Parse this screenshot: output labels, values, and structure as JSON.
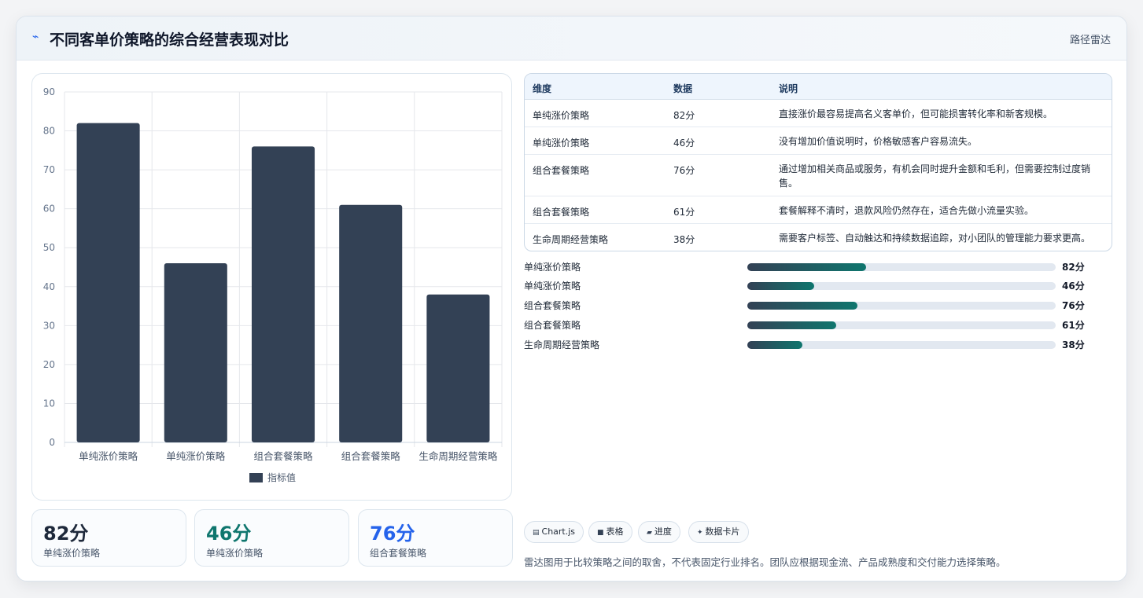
{
  "header": {
    "icon": "pulse-icon",
    "title": "不同客单价策略的综合经营表现对比",
    "badge": "路径雷达"
  },
  "chart_data": {
    "type": "bar",
    "categories": [
      "单纯涨价策略",
      "单纯涨价策略",
      "组合套餐策略",
      "组合套餐策略",
      "生命周期经营策略"
    ],
    "series": [
      {
        "name": "指标值",
        "values": [
          82,
          46,
          76,
          61,
          38
        ]
      }
    ],
    "ylim": [
      0,
      90
    ],
    "yticks": [
      0,
      10,
      20,
      30,
      40,
      50,
      60,
      70,
      80,
      90
    ],
    "grid": true,
    "legend": "bottom",
    "colors": {
      "bar": "#334155",
      "grid": "#e5e7eb",
      "axis_text": "#64748b"
    }
  },
  "kpis": [
    {
      "value": "82分",
      "label": "单纯涨价策略",
      "color": "#1e293b"
    },
    {
      "value": "46分",
      "label": "单纯涨价策略",
      "color": "#0f766e"
    },
    {
      "value": "76分",
      "label": "组合套餐策略",
      "color": "#2563eb"
    }
  ],
  "table": {
    "headers": [
      "维度",
      "数据",
      "说明"
    ],
    "rows": [
      [
        "单纯涨价策略",
        "82分",
        "直接涨价最容易提高名义客单价，但可能损害转化率和新客规模。"
      ],
      [
        "单纯涨价策略",
        "46分",
        "没有增加价值说明时，价格敏感客户容易流失。"
      ],
      [
        "组合套餐策略",
        "76分",
        "通过增加相关商品或服务，有机会同时提升金额和毛利，但需要控制过度销售。"
      ],
      [
        "组合套餐策略",
        "61分",
        "套餐解释不清时，退款风险仍然存在，适合先做小流量实验。"
      ],
      [
        "生命周期经营策略",
        "38分",
        "需要客户标签、自动触达和持续数据追踪，对小团队的管理能力要求更高。"
      ]
    ]
  },
  "progress": [
    {
      "label": "单纯涨价策略",
      "value": "82分",
      "fraction": 0.385
    },
    {
      "label": "单纯涨价策略",
      "value": "46分",
      "fraction": 0.216
    },
    {
      "label": "组合套餐策略",
      "value": "76分",
      "fraction": 0.357
    },
    {
      "label": "组合套餐策略",
      "value": "61分",
      "fraction": 0.287
    },
    {
      "label": "生命周期经营策略",
      "value": "38分",
      "fraction": 0.178
    }
  ],
  "tags": [
    {
      "icon": "chart-icon",
      "glyph": "▤",
      "label": "Chart.js"
    },
    {
      "icon": "table-icon",
      "glyph": "■",
      "label": "表格"
    },
    {
      "icon": "progress-icon",
      "glyph": "▰",
      "label": "进度"
    },
    {
      "icon": "card-icon",
      "glyph": "✦",
      "label": "数据卡片"
    }
  ],
  "note": "雷达图用于比较策略之间的取舍，不代表固定行业排名。团队应根据现金流、产品成熟度和交付能力选择策略。"
}
